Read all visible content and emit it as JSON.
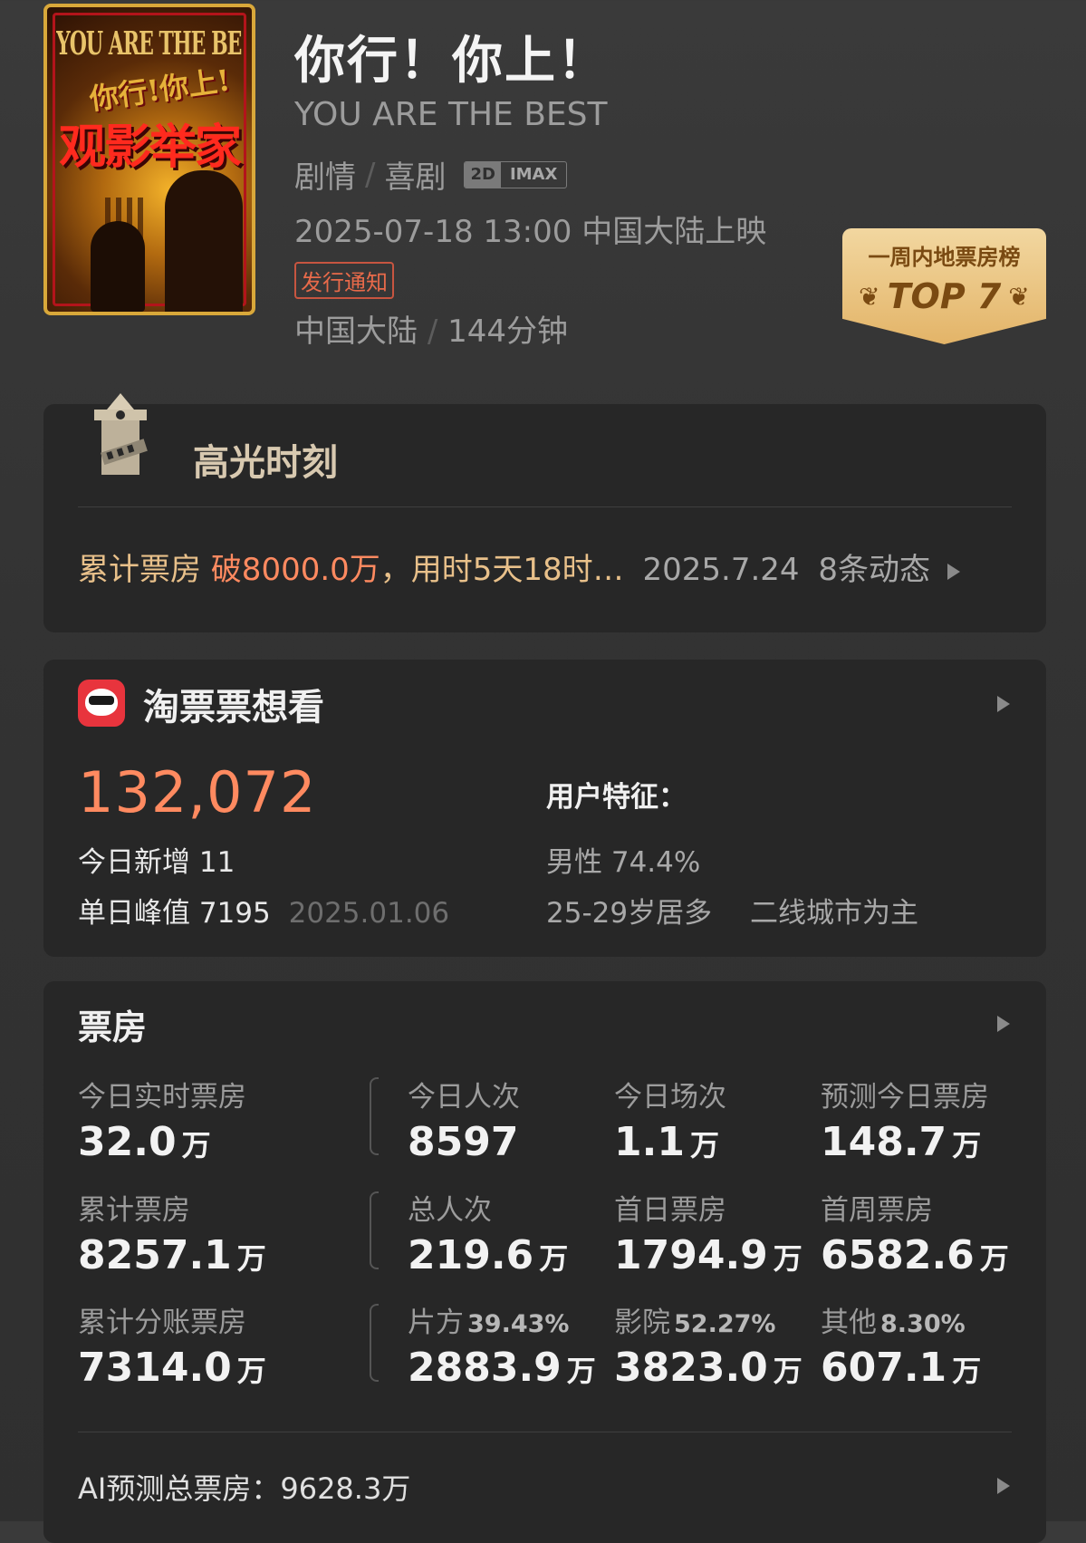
{
  "movie": {
    "poster_texts": [
      "YOU ARE THE BEST",
      "你行!你上!",
      "观影举家"
    ],
    "title": "你行！你上！",
    "subtitle": "YOU ARE THE BEST",
    "genres": [
      "剧情",
      "喜剧"
    ],
    "format_tags": [
      "2D",
      "IMAX"
    ],
    "release": "2025-07-18 13:00 中国大陆上映",
    "notice_tag": "发行通知",
    "region": "中国大陆",
    "duration": "144分钟",
    "separator": "/"
  },
  "rank_badge": {
    "label": "一周内地票房榜",
    "rank": "TOP 7"
  },
  "highlight": {
    "title": "高光时刻",
    "prefix": "累计票房 ",
    "amount": "破8000.0万",
    "suffix": "，用时5天18时…",
    "date": "2025.7.24",
    "updates": "8条动态"
  },
  "taopiaopiao": {
    "title": "淘票票想看",
    "want_count": "132,072",
    "today_new_label": "今日新增",
    "today_new_value": "11",
    "peak_label": "单日峰值",
    "peak_value": "7195",
    "peak_date": "2025.01.06",
    "user_feature_label": "用户特征：",
    "gender": "男性 74.4%",
    "age": "25-29岁居多",
    "city": "二线城市为主"
  },
  "boxoffice": {
    "title": "票房",
    "unit": "万",
    "row1": {
      "realtime_label": "今日实时票房",
      "realtime_value": "32.0",
      "viewers_label": "今日人次",
      "viewers_value": "8597",
      "shows_label": "今日场次",
      "shows_value": "1.1",
      "forecast_label": "预测今日票房",
      "forecast_value": "148.7"
    },
    "row2": {
      "total_label": "累计票房",
      "total_value": "8257.1",
      "total_viewers_label": "总人次",
      "total_viewers_value": "219.6",
      "first_day_label": "首日票房",
      "first_day_value": "1794.9",
      "first_week_label": "首周票房",
      "first_week_value": "6582.6"
    },
    "row3": {
      "split_label": "累计分账票房",
      "split_value": "7314.0",
      "producer_label": "片方",
      "producer_pct": "39.43%",
      "producer_value": "2883.9",
      "cinema_label": "影院",
      "cinema_pct": "52.27%",
      "cinema_value": "3823.0",
      "other_label": "其他",
      "other_pct": "8.30%",
      "other_value": "607.1"
    },
    "ai_forecast_label": "AI预测总票房：",
    "ai_forecast_value": "9628.3万"
  }
}
